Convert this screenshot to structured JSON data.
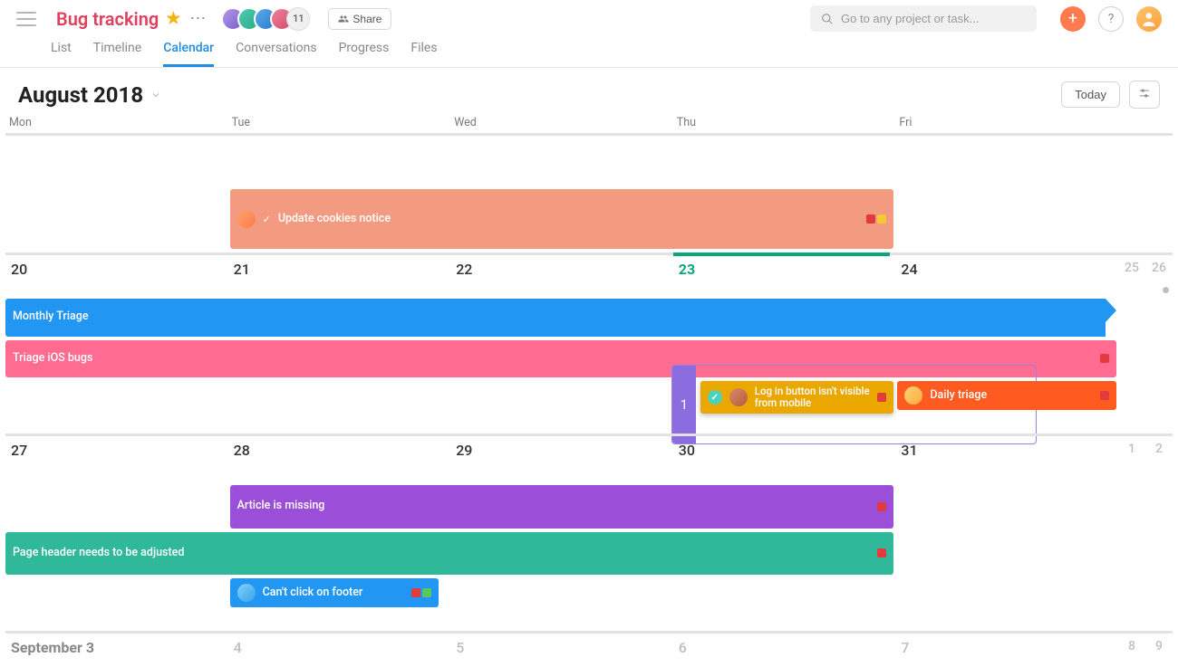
{
  "project": {
    "title": "Bug tracking",
    "starred": true,
    "member_overflow": "11",
    "share_label": "Share"
  },
  "tabs": {
    "list": "List",
    "timeline": "Timeline",
    "calendar": "Calendar",
    "conversations": "Conversations",
    "progress": "Progress",
    "files": "Files",
    "active": "calendar"
  },
  "search": {
    "placeholder": "Go to any project or task..."
  },
  "month": {
    "title": "August 2018",
    "today_label": "Today"
  },
  "day_headers": {
    "mon": "Mon",
    "tue": "Tue",
    "wed": "Wed",
    "thu": "Thu",
    "fri": "Fri"
  },
  "rows": {
    "r1": {
      "mon": "",
      "tue": "",
      "wed": "",
      "thu": "",
      "fri": "",
      "sat": "",
      "sun": ""
    },
    "r2": {
      "mon": "20",
      "tue": "21",
      "wed": "22",
      "thu": "23",
      "fri": "24",
      "sat": "25",
      "sun": "26"
    },
    "r3": {
      "mon": "27",
      "tue": "28",
      "wed": "29",
      "thu": "30",
      "fri": "31",
      "sat": "1",
      "sun": "2"
    },
    "r4": {
      "mon": "September 3",
      "tue": "4",
      "wed": "5",
      "thu": "6",
      "fri": "7",
      "sat": "8",
      "sun": "9"
    }
  },
  "events": {
    "update_cookies": "Update cookies notice",
    "monthly_triage": "Monthly Triage",
    "triage_ios": "Triage iOS bugs",
    "login_button": "Log in button isn't visible from mobile",
    "daily_triage": "Daily triage",
    "article_missing": "Article is missing",
    "page_header": "Page header needs to be adjusted",
    "cant_click_footer": "Can't click on footer"
  },
  "focus": {
    "counter": "1"
  },
  "colors": {
    "salmon": "#f39b80",
    "blue": "#2196f3",
    "pink": "#ff6b91",
    "amber": "#eaa700",
    "orange": "#ff5a1f",
    "purple": "#9b4fd8",
    "teal": "#2fb89a",
    "skyblue": "#2196f3"
  }
}
